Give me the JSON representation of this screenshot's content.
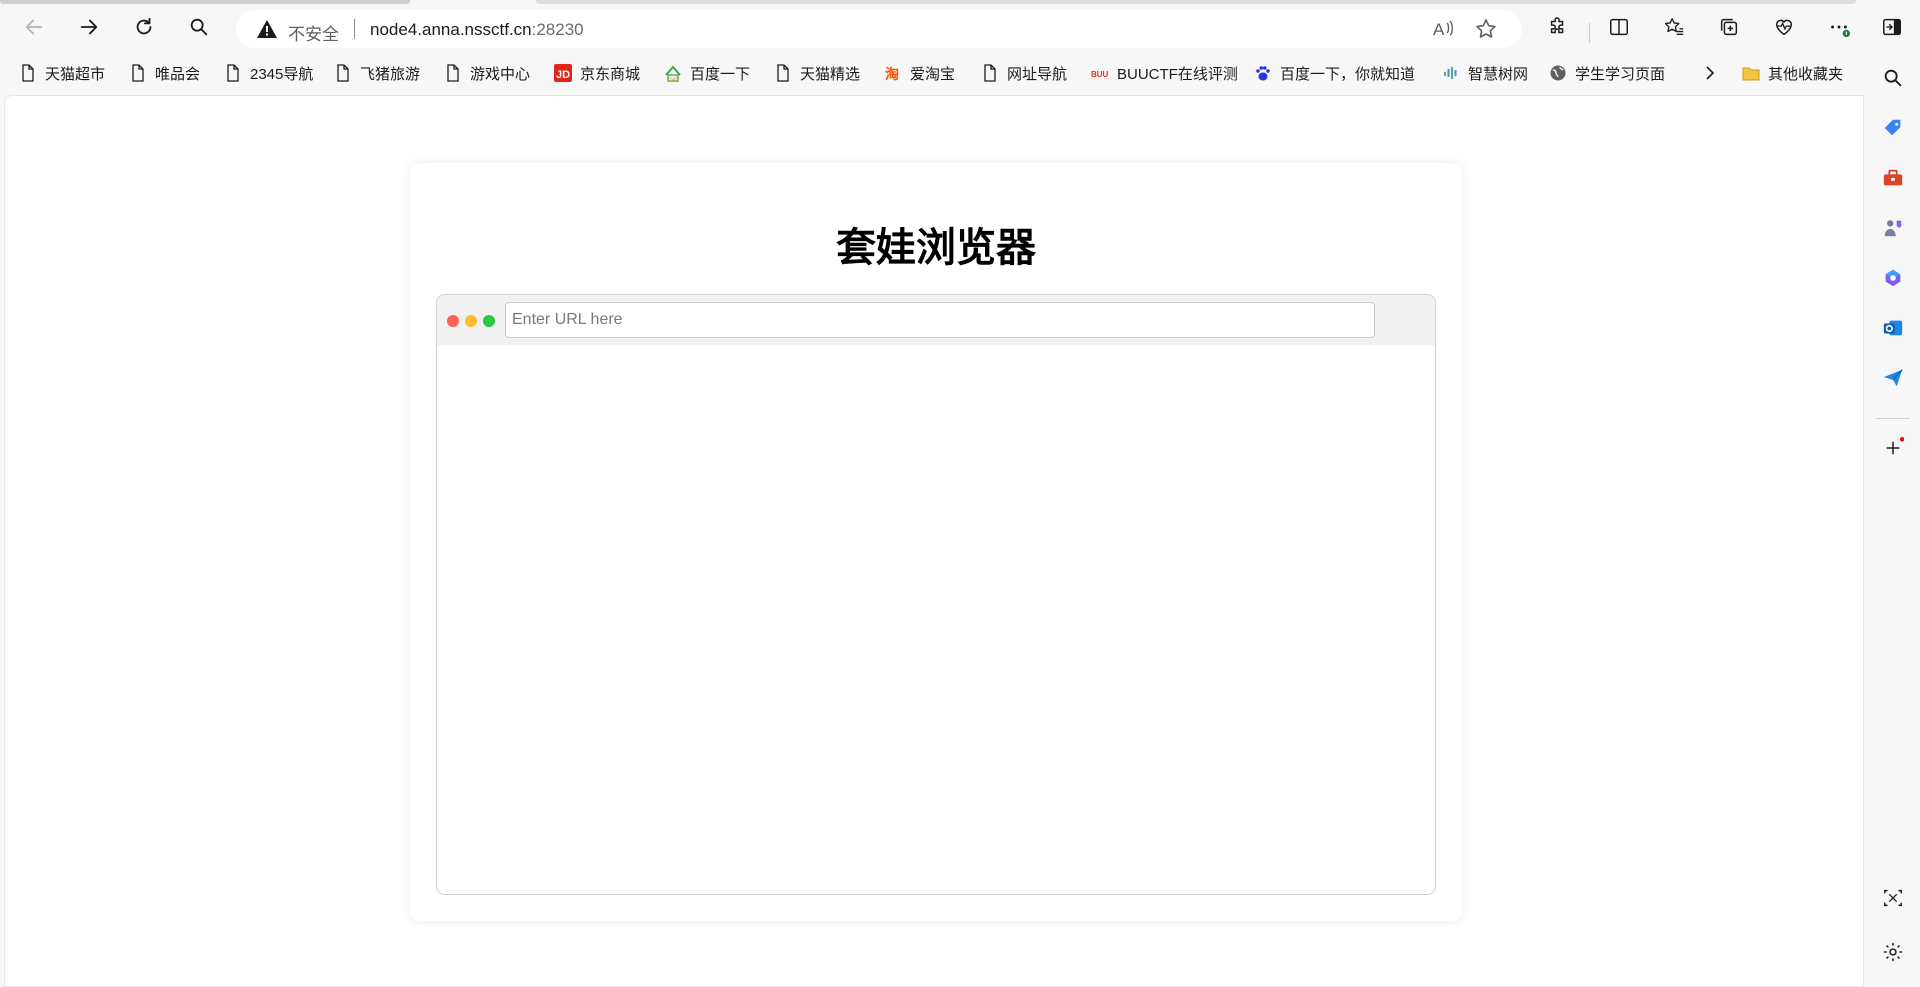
{
  "browser": {
    "address": {
      "security_label": "不安全",
      "host": "node4.anna.nssctf.cn",
      "port": ":28230"
    },
    "icons": {
      "back": "back-arrow-icon",
      "forward": "forward-arrow-icon",
      "refresh": "refresh-icon",
      "search": "search-icon",
      "read_aloud": "read-aloud-icon",
      "favorite": "star-icon",
      "extensions": "puzzle-icon",
      "split": "split-screen-icon",
      "favorites": "favorites-icon",
      "collections": "collections-icon",
      "health": "heart-pulse-icon",
      "more": "more-icon",
      "sidebar_toggle": "sidebar-toggle-icon"
    }
  },
  "bookmarks": [
    {
      "label": "天猫超市",
      "icon": "page-icon"
    },
    {
      "label": "唯品会",
      "icon": "page-icon"
    },
    {
      "label": "2345导航",
      "icon": "page-icon"
    },
    {
      "label": "飞猪旅游",
      "icon": "page-icon"
    },
    {
      "label": "游戏中心",
      "icon": "page-icon"
    },
    {
      "label": "京东商城",
      "icon": "jd-icon"
    },
    {
      "label": "百度一下",
      "icon": "2345-icon"
    },
    {
      "label": "天猫精选",
      "icon": "page-icon"
    },
    {
      "label": "爱淘宝",
      "icon": "taobao-icon"
    },
    {
      "label": "网址导航",
      "icon": "page-icon"
    },
    {
      "label": "BUUCTF在线评测",
      "icon": "buuctf-icon"
    },
    {
      "label": "百度一下，你就知道",
      "icon": "baidu-paw-icon"
    },
    {
      "label": "智慧树网",
      "icon": "zhihuishu-icon"
    },
    {
      "label": "学生学习页面",
      "icon": "globe-icon"
    }
  ],
  "bookmarks_overflow": "chevron-right-icon",
  "other_favorites": {
    "label": "其他收藏夹",
    "icon": "folder-icon"
  },
  "sidebar": {
    "icons": [
      "search-icon",
      "tag-icon",
      "toolbox-icon",
      "games-icon",
      "copilot-icon",
      "outlook-icon",
      "send-icon",
      "add-icon",
      "screenshot-icon",
      "settings-icon"
    ]
  },
  "page": {
    "title": "套娃浏览器",
    "url_input_placeholder": "Enter URL here",
    "dots": {
      "red": "#ff5f56",
      "yellow": "#ffbd2e",
      "green": "#27c93f"
    }
  }
}
